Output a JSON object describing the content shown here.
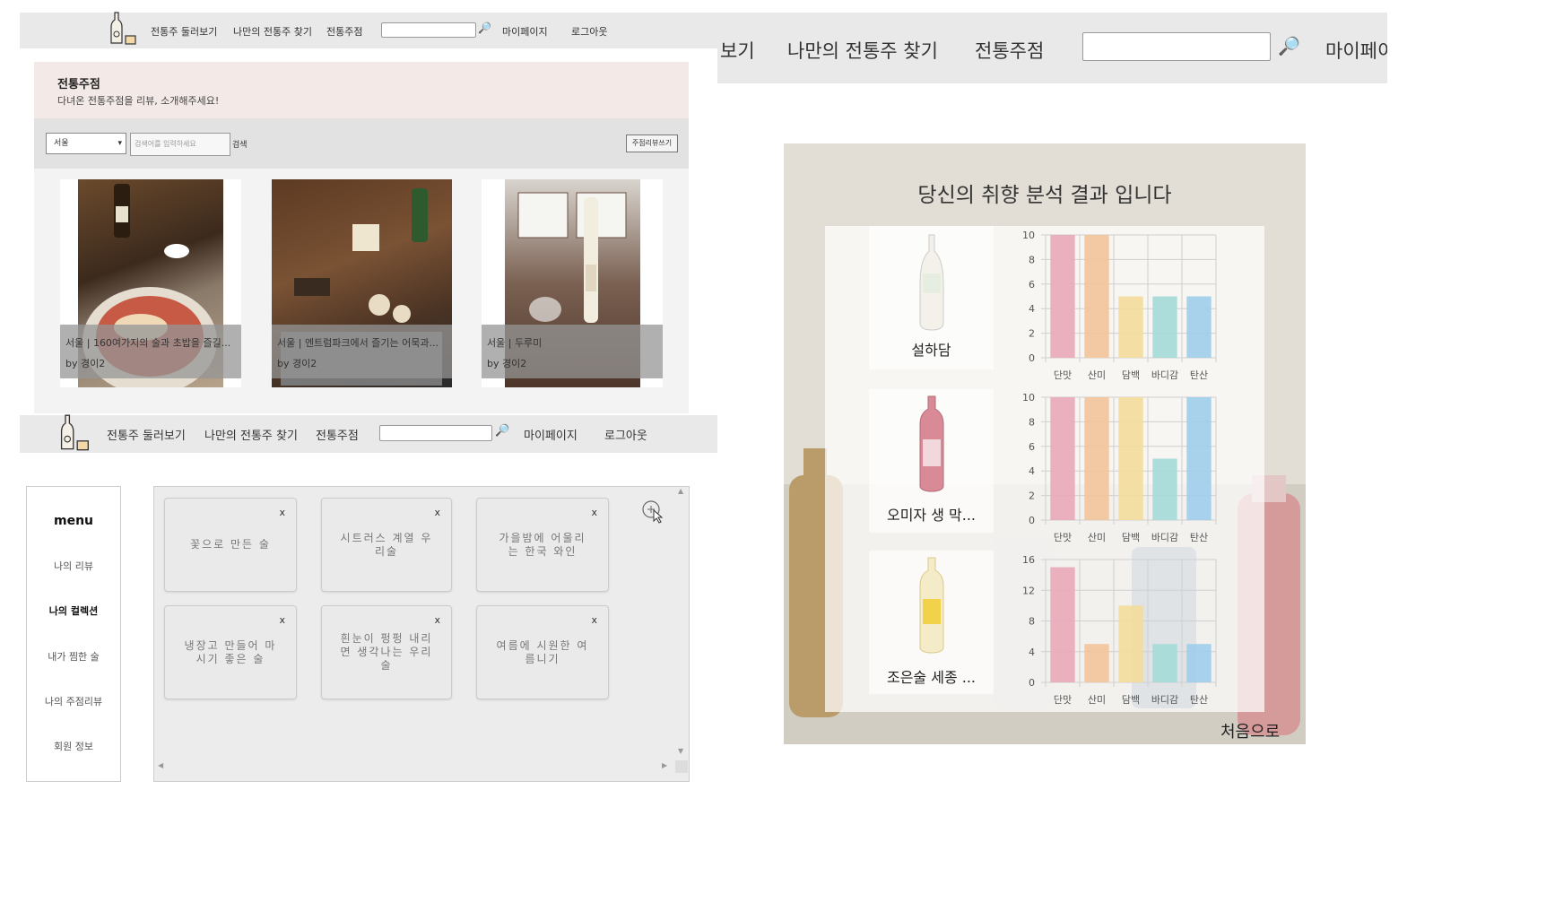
{
  "top_nav": {
    "items": [
      "전통주 둘러보기",
      "나만의 전통주 찾기",
      "전통주점"
    ],
    "mypage": "마이페이지",
    "logout": "로그아웃"
  },
  "pub_page": {
    "title": "전통주점",
    "subtitle": "다녀온 전통주점을 리뷰, 소개해주세요!",
    "region": "서울",
    "search_placeholder": "검색어를 입력하세요",
    "search_btn": "검색",
    "write_btn": "주점리뷰쓰기",
    "cards": [
      {
        "title": "서울 | 160여가지의 술과 초밥을 즐길...",
        "author": "by 경이2"
      },
      {
        "title": "서울 | 엔트럼파크에서 즐기는 어묵과...",
        "author": "by 경이2"
      },
      {
        "title": "서울 | 두루미",
        "author": "by 경이2"
      }
    ]
  },
  "collection_page": {
    "menu_title": "menu",
    "menu_items": [
      "나의 리뷰",
      "나의 컬렉션",
      "내가 찜한 술",
      "나의 주점리뷰",
      "회원 정보"
    ],
    "active_menu": "나의 컬렉션",
    "collections": [
      "꽃으로 만든 술",
      "시트러스 계열 우리술",
      "가을밤에 어울리는 한국 와인",
      "냉장고 만들어 마시기 좋은 술",
      "흰눈이 펑펑 내리면 생각나는 우리술",
      "여름에 시원한 여름니기"
    ],
    "close": "x"
  },
  "result_nav": {
    "items": [
      "보기",
      "나만의 전통주 찾기",
      "전통주점"
    ],
    "mypage": "마이페이"
  },
  "result_page": {
    "title": "당신의 취향 분석 결과 입니다",
    "back": "처음으로",
    "drinks": [
      "설하담",
      "오미자 생 막...",
      "조은술 세종 ..."
    ]
  },
  "chart_data": [
    {
      "type": "bar",
      "categories": [
        "단맛",
        "산미",
        "담백",
        "바디감",
        "탄산"
      ],
      "values": [
        10,
        10,
        5,
        5,
        5
      ],
      "ylim": [
        0,
        10
      ],
      "yticks": [
        0,
        2,
        4,
        6,
        8,
        10
      ],
      "colors": [
        "#e9a8b8",
        "#f2c49a",
        "#f3dc9a",
        "#a4dad8",
        "#9fcdeb"
      ],
      "grid": true
    },
    {
      "type": "bar",
      "categories": [
        "단맛",
        "산미",
        "담백",
        "바디감",
        "탄산"
      ],
      "values": [
        10,
        10,
        10,
        5,
        10
      ],
      "ylim": [
        0,
        10
      ],
      "yticks": [
        0,
        2,
        4,
        6,
        8,
        10
      ],
      "colors": [
        "#e9a8b8",
        "#f2c49a",
        "#f3dc9a",
        "#a4dad8",
        "#9fcdeb"
      ],
      "grid": true
    },
    {
      "type": "bar",
      "categories": [
        "단맛",
        "산미",
        "담백",
        "바디감",
        "탄산"
      ],
      "values": [
        15,
        5,
        10,
        5,
        5
      ],
      "ylim": [
        0,
        16
      ],
      "yticks": [
        0,
        4,
        8,
        12,
        16
      ],
      "colors": [
        "#e9a8b8",
        "#f2c49a",
        "#f3dc9a",
        "#a4dad8",
        "#9fcdeb"
      ],
      "grid": true
    }
  ]
}
